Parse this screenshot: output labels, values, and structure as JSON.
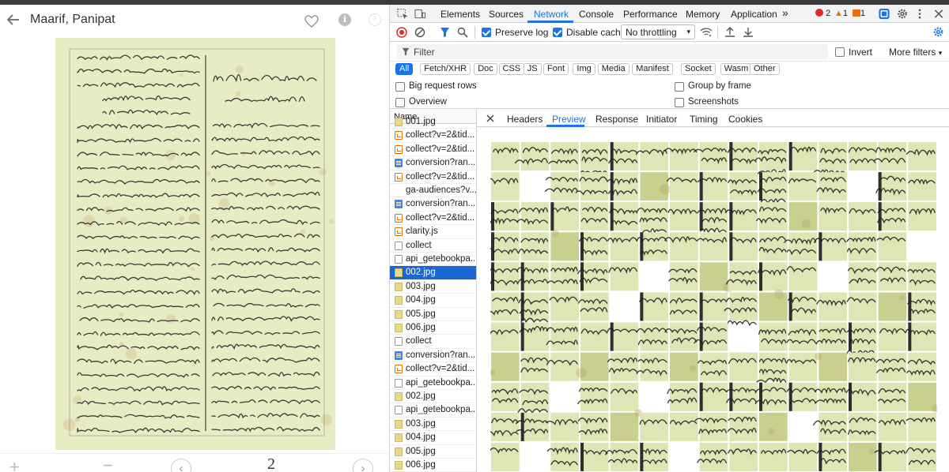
{
  "viewer": {
    "title": "Maarif, Panipat",
    "page_number": "2",
    "icons": [
      "back-arrow-icon",
      "heart-icon",
      "info-icon",
      "info-outline-icon",
      "zoom-in-icon",
      "zoom-out-icon",
      "chevron-left-icon",
      "chevron-right-icon"
    ]
  },
  "devtools": {
    "tabs": [
      "Elements",
      "Sources",
      "Network",
      "Console",
      "Performance",
      "Memory",
      "Application"
    ],
    "active_tab": "Network",
    "more_tabs": "»",
    "errors": "2",
    "warnings": "1",
    "issues": "1",
    "toolbar": {
      "preserve_log": "Preserve log",
      "disable_cache": "Disable cache",
      "throttling": "No throttling",
      "preserve_log_checked": true,
      "disable_cache_checked": true
    },
    "filter": {
      "placeholder": "Filter",
      "invert": "Invert",
      "more_filters": "More filters"
    },
    "type_chips": [
      "All",
      "Fetch/XHR",
      "Doc",
      "CSS",
      "JS",
      "Font",
      "Img",
      "Media",
      "Manifest",
      "Socket",
      "Wasm",
      "Other"
    ],
    "active_chip": "All",
    "options": {
      "big_request_rows": "Big request rows",
      "overview": "Overview",
      "group_by_frame": "Group by frame",
      "screenshots": "Screenshots"
    },
    "name_header": "Name",
    "requests": [
      {
        "name": "001.jpg",
        "type": "img"
      },
      {
        "name": "collect?v=2&tid...",
        "type": "script"
      },
      {
        "name": "collect?v=2&tid...",
        "type": "script"
      },
      {
        "name": "conversion?ran...",
        "type": "doc"
      },
      {
        "name": "collect?v=2&tid...",
        "type": "script"
      },
      {
        "name": "ga-audiences?v...",
        "type": "none"
      },
      {
        "name": "conversion?ran...",
        "type": "doc"
      },
      {
        "name": "collect?v=2&tid...",
        "type": "script"
      },
      {
        "name": "clarity.js",
        "type": "script"
      },
      {
        "name": "collect",
        "type": "other"
      },
      {
        "name": "api_getebookpa...",
        "type": "other"
      },
      {
        "name": "002.jpg",
        "type": "img",
        "selected": true
      },
      {
        "name": "003.jpg",
        "type": "img"
      },
      {
        "name": "004.jpg",
        "type": "img"
      },
      {
        "name": "005.jpg",
        "type": "img"
      },
      {
        "name": "006.jpg",
        "type": "img"
      },
      {
        "name": "collect",
        "type": "other"
      },
      {
        "name": "conversion?ran...",
        "type": "doc"
      },
      {
        "name": "collect?v=2&tid...",
        "type": "script"
      },
      {
        "name": "api_getebookpa...",
        "type": "other"
      },
      {
        "name": "002.jpg",
        "type": "img"
      },
      {
        "name": "api_getebookpa...",
        "type": "other"
      },
      {
        "name": "003.jpg",
        "type": "img"
      },
      {
        "name": "004.jpg",
        "type": "img"
      },
      {
        "name": "005.jpg",
        "type": "img"
      },
      {
        "name": "006.jpg",
        "type": "img"
      }
    ],
    "detail_tabs": [
      "Headers",
      "Preview",
      "Response",
      "Initiator",
      "Timing",
      "Cookies"
    ],
    "active_detail_tab": "Preview"
  },
  "colors": {
    "accent": "#1a73e8",
    "paper": "#e8ecc4",
    "tile": "#dde6b4",
    "ink": "#1c1c1c"
  }
}
